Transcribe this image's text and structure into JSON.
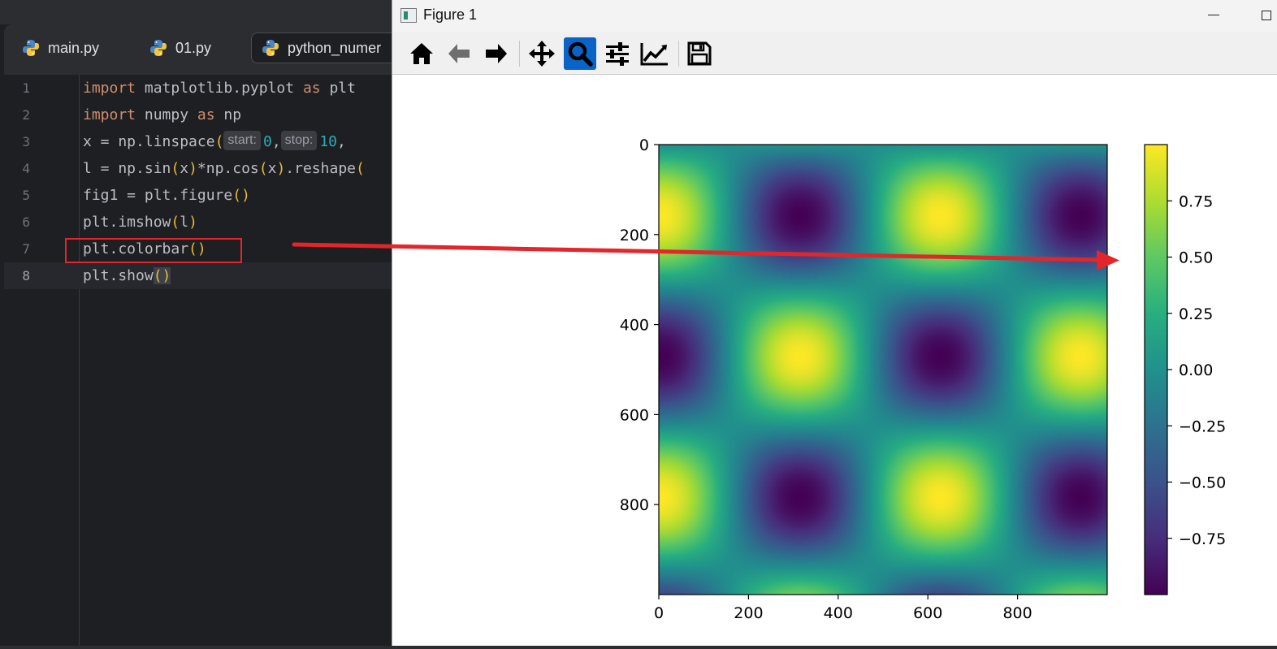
{
  "ide": {
    "tabs": [
      {
        "label": "main.py",
        "icon": "python-icon"
      },
      {
        "label": "01.py",
        "icon": "python-icon"
      },
      {
        "label": "python_numer",
        "icon": "python-icon",
        "active": true
      }
    ],
    "line_numbers": [
      "1",
      "2",
      "3",
      "4",
      "5",
      "6",
      "7",
      "8"
    ],
    "code": {
      "l1_kw1": "import",
      "l1_mod": " matplotlib.pyplot ",
      "l1_kw2": "as",
      "l1_alias": " plt",
      "l2_kw1": "import",
      "l2_mod": " numpy ",
      "l2_kw2": "as",
      "l2_alias": " np",
      "l3_pre": "x = np.linspace",
      "l3_hint_start": "start:",
      "l3_v0": "0",
      "l3_comma": ",",
      "l3_hint_stop": "stop:",
      "l3_v1": "10",
      "l3_tail": ",",
      "l4_pre": "l = np.sin",
      "l4_arg1": "x",
      "l4_mid": "*np.cos",
      "l4_arg2": "x",
      "l4_post": ".reshape",
      "l5_pre": "fig1 = plt.figure",
      "l6_pre": "plt.imshow",
      "l6_arg": "l",
      "l7_pre": "plt.colorbar",
      "l8_pre": "plt.show",
      "open_paren": "(",
      "close_paren": ")",
      "empty_call": "()"
    }
  },
  "figure": {
    "title": "Figure 1",
    "toolbar": [
      {
        "name": "home-button",
        "icon": "home-icon"
      },
      {
        "name": "back-button",
        "icon": "arrow-left-icon"
      },
      {
        "name": "forward-button",
        "icon": "arrow-right-icon"
      },
      {
        "name": "pan-button",
        "icon": "move-icon"
      },
      {
        "name": "zoom-button",
        "icon": "magnifier-icon",
        "active": true
      },
      {
        "name": "subplots-button",
        "icon": "sliders-icon"
      },
      {
        "name": "edit-axes-button",
        "icon": "line-chart-icon"
      },
      {
        "name": "save-button",
        "icon": "floppy-disk-icon"
      }
    ]
  },
  "chart_data": {
    "type": "heatmap",
    "colormap": "viridis",
    "function": "sin(x)*cos(y), x,y in [0,10], 1000x1000",
    "x_ticks": [
      "0",
      "200",
      "400",
      "600",
      "800"
    ],
    "y_ticks": [
      "0",
      "200",
      "400",
      "600",
      "800"
    ],
    "xlim": [
      0,
      1000
    ],
    "ylim": [
      1000,
      0
    ],
    "colorbar": {
      "ticks": [
        "0.75",
        "0.50",
        "0.25",
        "0.00",
        "−0.25",
        "−0.50",
        "−0.75"
      ],
      "tick_values": [
        0.75,
        0.5,
        0.25,
        0.0,
        -0.25,
        -0.5,
        -0.75
      ],
      "range": [
        -1,
        1
      ]
    },
    "grid": false
  },
  "colors": {
    "annotation": "#e3262a",
    "zoom_active": "#0a64c8"
  }
}
